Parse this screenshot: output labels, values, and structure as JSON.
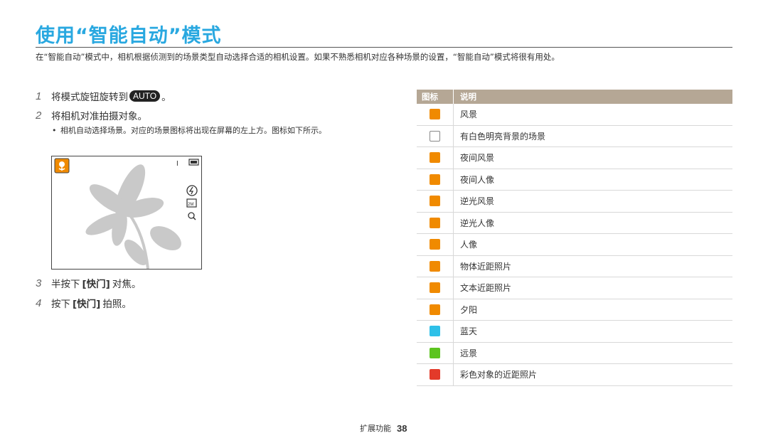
{
  "page": {
    "title": "使用“智能自动”模式",
    "intro": "在“智能自动”模式中，相机根据侦测到的场景类型自动选择合适的相机设置。如果不熟悉相机对应各种场景的设置，“智能自动”模式将很有用处。"
  },
  "steps": [
    {
      "num": "1",
      "before": "将模式旋钮旋转到",
      "badge": "AUTO",
      "after": "。"
    },
    {
      "num": "2",
      "text": "将相机对准拍摄对象。"
    },
    {
      "num": "3",
      "before": "半按下",
      "key": "[快门]",
      "after": "对焦。"
    },
    {
      "num": "4",
      "before": "按下",
      "key": "[快门]",
      "after": "拍照。"
    }
  ],
  "bullet": {
    "mark": "•",
    "text": "相机自动选择场景。对应的场景图标将出现在屏幕的左上方。图标如下所示。"
  },
  "screen": {
    "battery_icon": "battery-icon",
    "flash_icon": "flash-icon",
    "indicator": "I"
  },
  "table": {
    "headers": {
      "icon": "图标",
      "desc": "说明"
    },
    "rows": [
      {
        "icon": "landscape-icon",
        "color": "#f08a00",
        "label": "风景"
      },
      {
        "icon": "white-background-icon",
        "color": "#ffffff",
        "label": "有白色明亮背景的场景"
      },
      {
        "icon": "night-landscape-icon",
        "color": "#f08a00",
        "label": "夜间风景"
      },
      {
        "icon": "night-portrait-icon",
        "color": "#f08a00",
        "label": "夜间人像"
      },
      {
        "icon": "backlight-landscape-icon",
        "color": "#f08a00",
        "label": "逆光风景"
      },
      {
        "icon": "backlight-portrait-icon",
        "color": "#f08a00",
        "label": "逆光人像"
      },
      {
        "icon": "portrait-icon",
        "color": "#f08a00",
        "label": "人像"
      },
      {
        "icon": "macro-icon",
        "color": "#f08a00",
        "label": "物体近距照片"
      },
      {
        "icon": "text-macro-icon",
        "color": "#f08a00",
        "label": "文本近距照片"
      },
      {
        "icon": "sunset-icon",
        "color": "#f08a00",
        "label": "夕阳"
      },
      {
        "icon": "blue-sky-icon",
        "color": "#2ec0e8",
        "label": "蓝天"
      },
      {
        "icon": "natural-green-icon",
        "color": "#5cc41e",
        "label": "远景"
      },
      {
        "icon": "macro-color-icon",
        "color": "#e33a2a",
        "label": "彩色对象的近距照片"
      }
    ]
  },
  "footer": {
    "section": "扩展功能",
    "page_number": "38"
  }
}
